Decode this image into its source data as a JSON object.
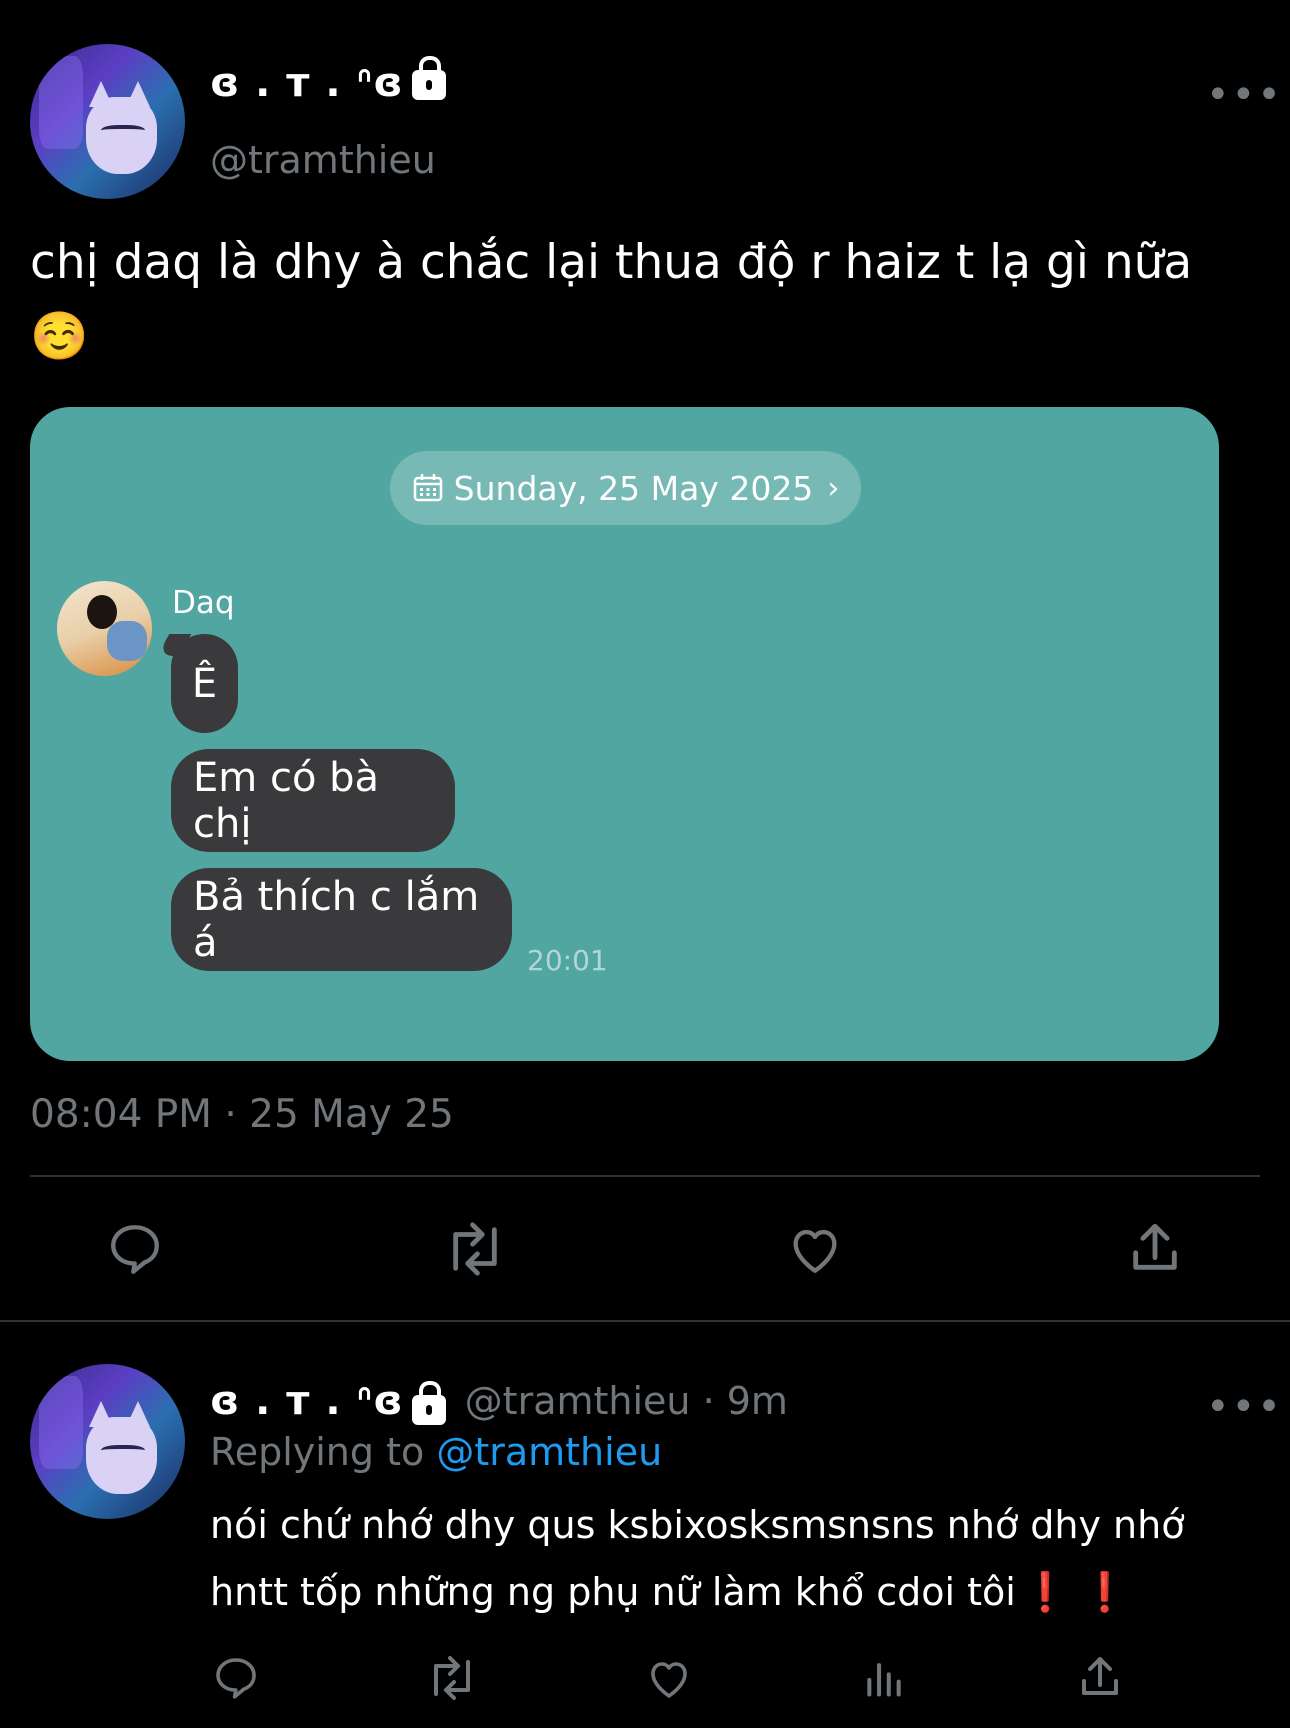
{
  "tweet": {
    "display_name": "ɞ . ᴛ . ᐢɞ",
    "handle": "@tramthieu",
    "more": "•••",
    "text": "chị daq là dhy à chắc lại thua độ r haiz t lạ gì nữa",
    "emoji": "☺️",
    "timestamp": "08:04 PM · 25 May 25"
  },
  "chat_card": {
    "date_label": "Sunday, 25 May 2025",
    "sender_name": "Daq",
    "messages": [
      "Ê",
      "Em có bà chị",
      "Bả thích c lắm á"
    ],
    "time": "20:01",
    "colors": {
      "background": "#51a6a1",
      "bubble": "#3a3a3c"
    }
  },
  "reply": {
    "display_name": "ɞ . ᴛ . ᐢɞ",
    "handle_time": "@tramthieu · 9m",
    "replying_prefix": "Replying to",
    "replying_handle": "@tramthieu",
    "text_line1": "nói chứ nhớ dhy qus ksbixosksmsnsns nhớ dhy nhớ",
    "text_line2": "hntt tốp những ng phụ nữ làm khổ cdoi tôi",
    "marks": "❗ ❗",
    "more": "•••"
  },
  "icons": {
    "reply": "speech-bubble-icon",
    "retweet": "retweet-icon",
    "like": "heart-icon",
    "share": "share-icon",
    "views": "bar-chart-icon"
  },
  "colors": {
    "background": "#000000",
    "text": "#e7e9ea",
    "muted": "#71767b",
    "link": "#1d9bf0"
  }
}
